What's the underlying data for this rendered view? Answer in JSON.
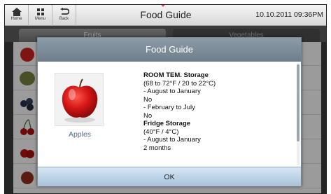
{
  "topbar": {
    "home_label": "Home",
    "menu_label": "Menu",
    "back_label": "Back",
    "title": "Food Guide",
    "datetime": "10.10.2011 09:36PM"
  },
  "tabs": {
    "fruits": "Fruits",
    "vegetables": "Vegetables"
  },
  "dialog": {
    "title": "Food Guide",
    "item_name": "Apples",
    "details": [
      {
        "text": "ROOM TEM. Storage",
        "header": true
      },
      {
        "text": "(68 to 72°F / 20 to 22°C)",
        "header": false
      },
      {
        "text": "- August to January",
        "header": false
      },
      {
        "text": "No",
        "header": false
      },
      {
        "text": "- February to July",
        "header": false
      },
      {
        "text": "No",
        "header": false
      },
      {
        "text": "Fridge Storage",
        "header": true
      },
      {
        "text": "(40°F / 4°C)",
        "header": false
      },
      {
        "text": "- August to January",
        "header": false
      },
      {
        "text": "2 months",
        "header": false
      }
    ],
    "ok_label": "OK"
  },
  "colors": {
    "dialog_header": "#7b8997",
    "item_name_text": "#4b6b8f",
    "footer": "#bcd2e6"
  },
  "icons": [
    "home-icon",
    "menu-grid-icon",
    "back-arrow-icon",
    "apple-image"
  ]
}
